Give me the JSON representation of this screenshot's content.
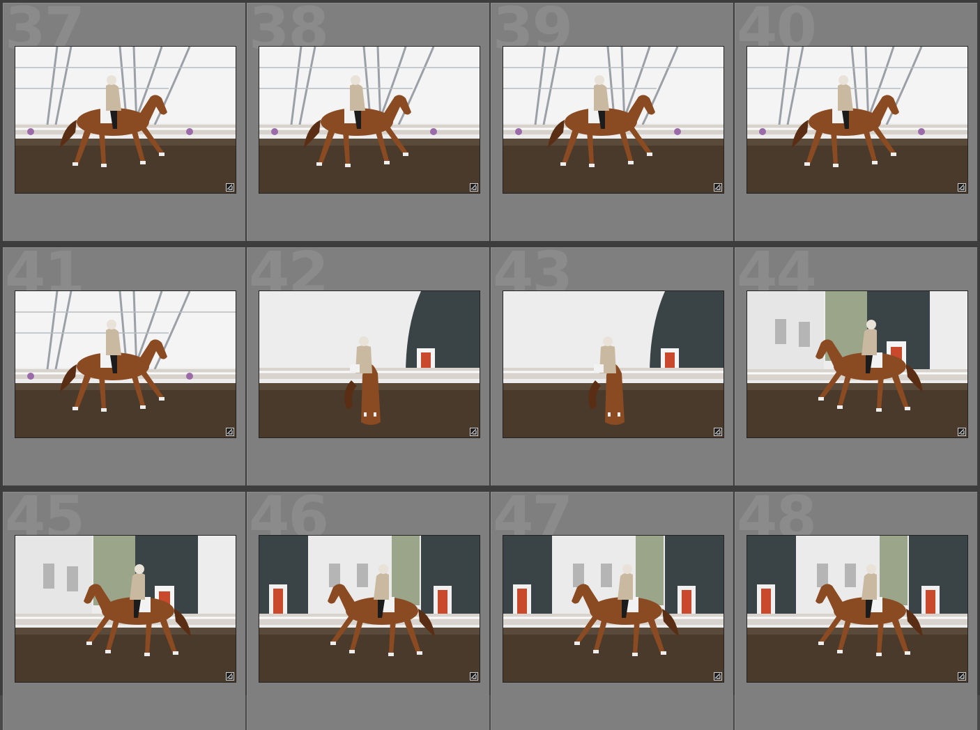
{
  "colors": {
    "cell_background": "#7f7f7f",
    "index_text": "#8b8b8b",
    "grid_gutter": "#3d3d3d"
  },
  "icons": {
    "thumbnail_badge": "develop-adjustment-icon"
  },
  "grid": {
    "columns": 4,
    "rows": 3,
    "cells": [
      {
        "index": "37",
        "scene": "side-structure",
        "facing": "right",
        "selected": false
      },
      {
        "index": "38",
        "scene": "side-structure",
        "facing": "right",
        "selected": false
      },
      {
        "index": "39",
        "scene": "side-structure",
        "facing": "right",
        "selected": false
      },
      {
        "index": "40",
        "scene": "side-structure",
        "facing": "right",
        "selected": false
      },
      {
        "index": "41",
        "scene": "side-structure",
        "facing": "right",
        "selected": false
      },
      {
        "index": "42",
        "scene": "front-door",
        "facing": "front",
        "selected": false
      },
      {
        "index": "43",
        "scene": "front-door",
        "facing": "front",
        "selected": false
      },
      {
        "index": "44",
        "scene": "left-trees",
        "facing": "left",
        "selected": false
      },
      {
        "index": "45",
        "scene": "left-trees",
        "facing": "left",
        "selected": false
      },
      {
        "index": "46",
        "scene": "left-two-doors",
        "facing": "left",
        "selected": false
      },
      {
        "index": "47",
        "scene": "left-two-doors",
        "facing": "left",
        "selected": false
      },
      {
        "index": "48",
        "scene": "left-two-doors",
        "facing": "left",
        "selected": false
      }
    ]
  }
}
